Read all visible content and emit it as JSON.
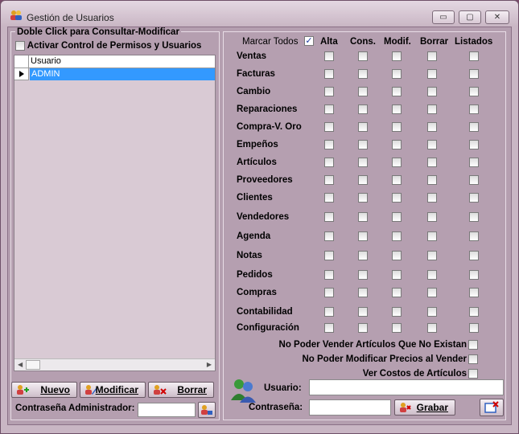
{
  "window": {
    "title": "Gestión de Usuarios",
    "minimize": "▭",
    "maximize": "▢",
    "close": "✕"
  },
  "left": {
    "group_title": "Doble Click para Consultar-Modificar",
    "activar_label": "Activar Control de Permisos y Usuarios",
    "grid": {
      "header": "Usuario",
      "rows": [
        "ADMIN"
      ]
    },
    "buttons": {
      "nuevo": "Nuevo",
      "modificar": "Modificar",
      "borrar": "Borrar"
    },
    "admin_password_label": "Contraseña Administrador:"
  },
  "right": {
    "marcar_todos": "Marcar Todos",
    "columns": [
      "Alta",
      "Cons.",
      "Modif.",
      "Borrar",
      "Listados"
    ],
    "modules": [
      "Ventas",
      "Facturas",
      "Cambio",
      "Reparaciones",
      "Compra-V. Oro",
      "Empeños",
      "Artículos",
      "Proveedores",
      "Clientes",
      "Vendedores",
      "Agenda",
      "Notas",
      "Pedidos",
      "Compras",
      "Contabilidad",
      "Configuración"
    ],
    "options": [
      "No Poder Vender Artículos Que No Existan",
      "No Poder Modificar Precios al Vender",
      "Ver Costos de Artículos"
    ],
    "usuario_label": "Usuario:",
    "password_label": "Contraseña:",
    "grabar": "Grabar"
  },
  "colors": {
    "selection": "#3399ff",
    "window_bg": "#c9b6c4",
    "panel_bg": "#b59fb0"
  }
}
